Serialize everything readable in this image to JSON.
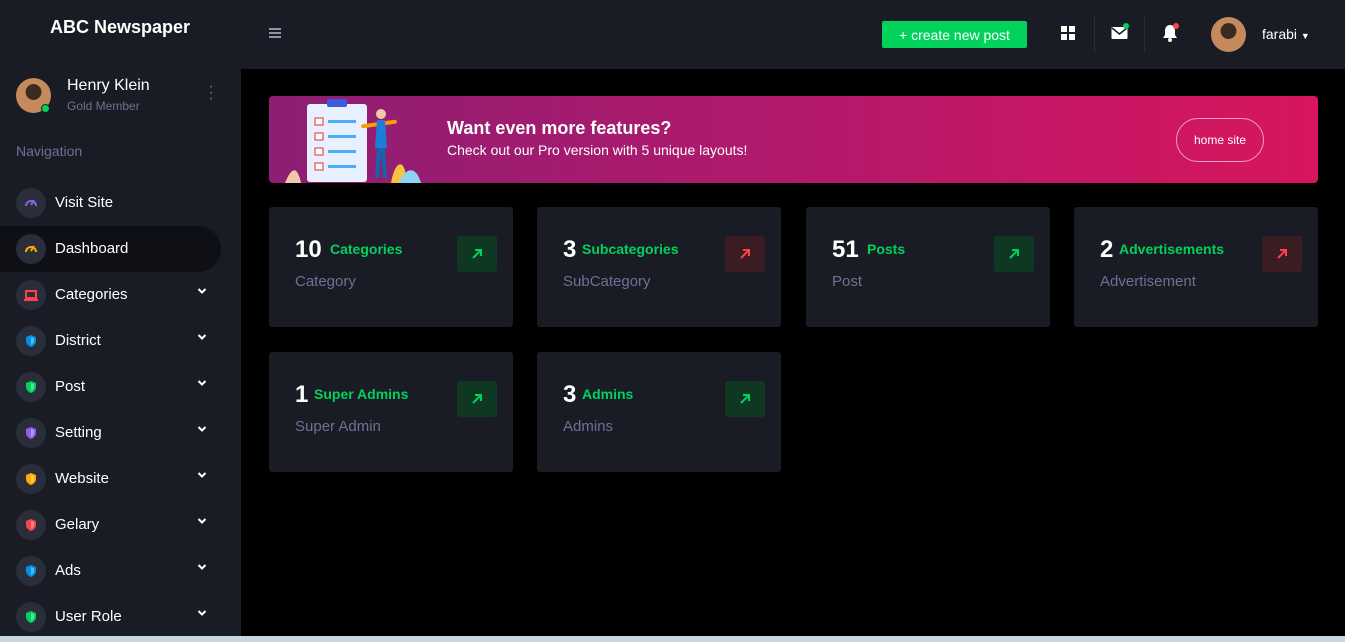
{
  "brand": "ABC Newspaper",
  "profile": {
    "name": "Henry Klein",
    "role": "Gold Member"
  },
  "navigation": {
    "title": "Navigation",
    "items": [
      {
        "label": "Visit Site",
        "icon": "speedometer-icon",
        "color": "#8f5fe8",
        "has_submenu": false,
        "active": false
      },
      {
        "label": "Dashboard",
        "icon": "speedometer-icon",
        "color": "#ffab00",
        "has_submenu": false,
        "active": true
      },
      {
        "label": "Categories",
        "icon": "laptop-icon",
        "color": "#fc424a",
        "has_submenu": true,
        "active": false
      },
      {
        "label": "District",
        "icon": "shield-icon",
        "color": "#0090e7",
        "has_submenu": true,
        "active": false
      },
      {
        "label": "Post",
        "icon": "shield-icon",
        "color": "#00d25b",
        "has_submenu": true,
        "active": false
      },
      {
        "label": "Setting",
        "icon": "shield-icon",
        "color": "#8f5fe8",
        "has_submenu": true,
        "active": false
      },
      {
        "label": "Website",
        "icon": "shield-icon",
        "color": "#ffab00",
        "has_submenu": true,
        "active": false
      },
      {
        "label": "Gelary",
        "icon": "shield-icon",
        "color": "#fc424a",
        "has_submenu": true,
        "active": false
      },
      {
        "label": "Ads",
        "icon": "shield-icon",
        "color": "#0090e7",
        "has_submenu": true,
        "active": false
      },
      {
        "label": "User Role",
        "icon": "shield-icon",
        "color": "#00d25b",
        "has_submenu": true,
        "active": false
      }
    ]
  },
  "topbar": {
    "create_label": "+ create new post",
    "user_name": "farabi",
    "icons": [
      "grid-icon",
      "mail-icon",
      "bell-icon"
    ]
  },
  "banner": {
    "title": "Want even more features?",
    "subtitle": "Check out our Pro version with 5 unique layouts!",
    "button_label": "home site"
  },
  "cards": [
    {
      "number": "10",
      "label": "Categories",
      "sub": "Category",
      "trend": "up"
    },
    {
      "number": "3",
      "label": "Subcategories",
      "sub": "SubCategory",
      "trend": "down"
    },
    {
      "number": "51",
      "label": "Posts",
      "sub": "Post",
      "trend": "up"
    },
    {
      "number": "2",
      "label": "Advertisements",
      "sub": "Advertisement",
      "trend": "down"
    },
    {
      "number": "1",
      "label": "Super Admins",
      "sub": "Super Admin",
      "trend": "up"
    },
    {
      "number": "3",
      "label": "Admins",
      "sub": "Admins",
      "trend": "up"
    }
  ],
  "colors": {
    "accent_green": "#00d25b",
    "accent_red": "#fc424a",
    "sidebar_bg": "#191c24",
    "page_bg": "#000000"
  }
}
